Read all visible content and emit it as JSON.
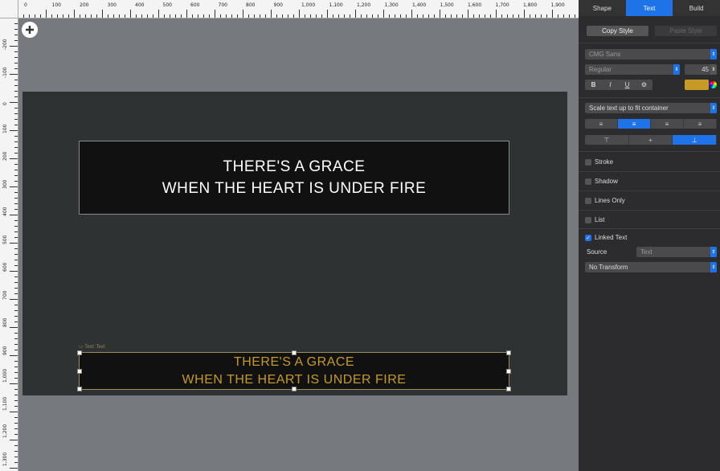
{
  "ruler": {
    "top_labels": [
      "0",
      "100",
      "200",
      "300",
      "400",
      "500",
      "600",
      "700",
      "800",
      "900",
      "1,000",
      "1,100",
      "1,200",
      "1,300",
      "1,400",
      "1,500",
      "1,600",
      "1,700",
      "1,800",
      "1,900"
    ],
    "left_labels": [
      "-200",
      "-100",
      "0",
      "100",
      "200",
      "300",
      "400",
      "500",
      "600",
      "700",
      "800",
      "900",
      "1,000",
      "1,100",
      "1,200",
      "1,300"
    ]
  },
  "slide": {
    "main_text": {
      "line1": "THERE'S A GRACE",
      "line2": "WHEN THE HEART IS UNDER FIRE"
    },
    "linked_text": {
      "label": "Text: Text",
      "line1": "THERE'S A GRACE",
      "line2": "WHEN THE HEART IS UNDER FIRE",
      "color": "#c59a25"
    }
  },
  "inspector": {
    "tabs": [
      "Shape",
      "Text",
      "Build"
    ],
    "active_tab": "Text",
    "copy_style": "Copy Style",
    "paste_style": "Paste Style",
    "font_family": "CMG Sans",
    "font_weight": "Regular",
    "font_size": "45",
    "style_buttons": [
      "B",
      "I",
      "U",
      "⚙"
    ],
    "text_color": "#c59a25",
    "scale_mode": "Scale text up to fit container",
    "stroke": "Stroke",
    "shadow": "Shadow",
    "lines_only": "Lines Only",
    "list": "List",
    "linked_text": "Linked Text",
    "source_label": "Source",
    "source_value": "Text",
    "transform": "No Transform"
  }
}
